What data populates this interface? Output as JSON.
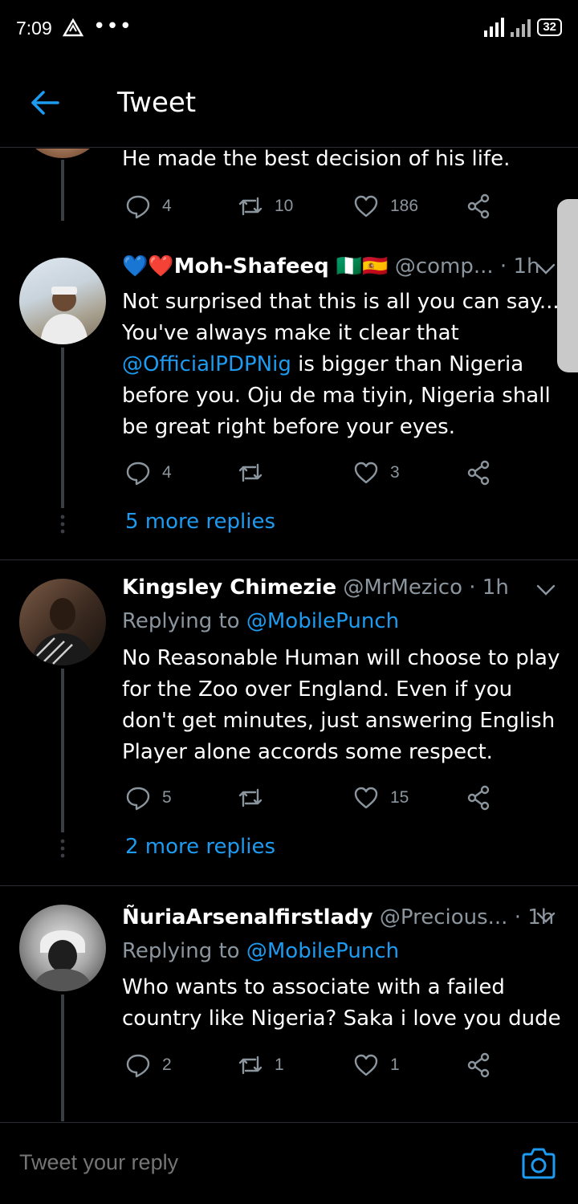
{
  "status_bar": {
    "time": "7:09",
    "dots": "•••",
    "battery": "32"
  },
  "top_bar": {
    "title": "Tweet"
  },
  "tweets": [
    {
      "text_lines": [
        "He made the best decision of his life."
      ],
      "actions": {
        "replies": "4",
        "retweets": "10",
        "likes": "186"
      }
    },
    {
      "name": "💙❤️Moh-Shafeeq 🇳🇬🇪🇸",
      "handle": "@comp...",
      "time": "· 1h",
      "text_before": "Not surprised that this is all you can say... You've always make it clear that ",
      "mention": "@OfficialPDPNig",
      "text_after": " is bigger than Nigeria before you. Oju de ma tiyin, Nigeria shall be great right before your eyes.",
      "actions": {
        "replies": "4",
        "retweets": "",
        "likes": "3"
      },
      "more_replies": "5 more replies"
    },
    {
      "name": "Kingsley Chimezie",
      "handle": "@MrMezico",
      "time": "· 1h",
      "replying_prefix": "Replying to ",
      "replying_to": "@MobilePunch",
      "text": "No Reasonable Human will choose to play for the Zoo over England. Even if you don't get minutes, just answering English Player alone accords some respect.",
      "actions": {
        "replies": "5",
        "retweets": "",
        "likes": "15"
      },
      "more_replies": "2 more replies"
    },
    {
      "name": "ÑuriaArsenalfirstlady",
      "handle": "@Precious...",
      "time": "· 1h",
      "replying_prefix": "Replying to ",
      "replying_to": "@MobilePunch",
      "text": "Who wants to associate with a failed country like Nigeria? Saka i love you dude",
      "actions": {
        "replies": "2",
        "retweets": "1",
        "likes": "1"
      }
    }
  ],
  "reply_bar": {
    "placeholder": "Tweet your reply"
  },
  "colors": {
    "link": "#1d9bf0",
    "muted": "#8b959e",
    "background": "#000000",
    "divider": "#2a2d31"
  }
}
